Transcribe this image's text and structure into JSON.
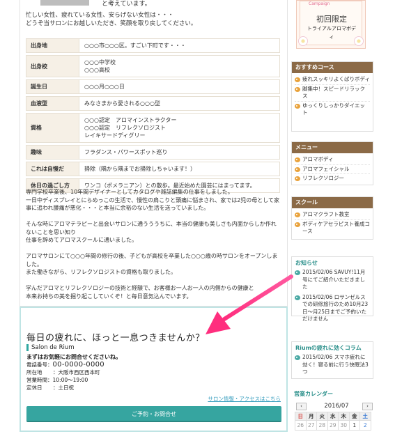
{
  "intro": {
    "tail": "と考えています。",
    "lines": [
      "忙しい女性、疲れている女性、安らげない女性は・・・",
      "どうぞ当サロンにお越しいただき、笑顔を取り戻してください。"
    ]
  },
  "profile": [
    {
      "key": "出身地",
      "value": [
        "○○○市○○○区。すごい下町です・・・"
      ]
    },
    {
      "key": "出身校",
      "value": [
        "○○○中学校",
        "○○○高校"
      ]
    },
    {
      "key": "誕生日",
      "value": [
        "○○○月○○○日"
      ]
    },
    {
      "key": "血液型",
      "value": [
        "みなさまから愛される○○○型"
      ]
    },
    {
      "key": "資格",
      "value": [
        "○○○認定　アロマインストラクター",
        "○○○認定　リフレクソロジスト",
        "レイキサードディグリー"
      ]
    },
    {
      "key": "趣味",
      "value": [
        "フラダンス・パワースポット巡り"
      ]
    },
    {
      "key": "これは自慢だ",
      "value": [
        "掃除（隅から隅までお掃除しちゃいます！）"
      ]
    },
    {
      "key": "休日の過ごし方",
      "value": [
        "ワンコ（ポメラニアン）との散歩。最近始めた園芸にはまってます。"
      ]
    }
  ],
  "body": [
    [
      "専門学校卒業後、10年間デザイナーとしてカタログや雑誌編集の仕事をしました。",
      "一日中ディスプレイとにらめっこの生活で、慢性の肩こりと頭痛に悩まされ、家では2児の母として家事に追われ腰痛が悪化・・・と本当に余裕のない生活を送っていました。"
    ],
    [
      "そんな時にアロマテラピーと出会いサロンに通うううちに、本当の健康も美しさも内面からしか作れないことを思い知り",
      "仕事を辞めてアロマスクールに通いました。"
    ],
    [
      "アロマサロンにて○○○年間の修行の後、子どもが高校を卒業した○○○歳の時サロンをオープンしました。",
      "また働きながら、リフレクソロジストの資格も取りました。"
    ],
    [
      "学んだアロマとリフレクソロジーの技術と経験で、お客様お一人お一人の内側からの健康と",
      "本来お持ちの美を掘り起こしていくぞ！と毎日意気込んでいます。"
    ]
  ],
  "salon": {
    "title": "毎日の疲れに、ほっと一息つきませんか？",
    "name": "Salon de Rium",
    "lead": "まずはお気軽にお問合せくださいね。",
    "tel_label": "電話番号：",
    "tel": "00-0000-0000",
    "addr_label": "所在地",
    "addr": "：大阪市西区西本町",
    "hours_label": "営業時間：",
    "hours": "10:00～19:00",
    "holiday_label": "定休日",
    "holiday": "：土日祝",
    "link": "サロン情報・アクセスはこちら",
    "button": "ご予約・お問合せ"
  },
  "banner": {
    "bunting": "Campaign",
    "title": "初回限定",
    "sub": "トライアルアロマボデ",
    "sub2": "ィ"
  },
  "sidebar": {
    "course": {
      "title": "おすすめコース",
      "items": [
        "疲れスッキリよくばりボディ",
        "脚集中！スピードリラックス",
        "ゆっくりしっかりダイエット"
      ]
    },
    "menu": {
      "title": "メニュー",
      "items": [
        "アロマボディ",
        "アロマフェイシャル",
        "リフレクソロジー"
      ]
    },
    "school": {
      "title": "スクール",
      "items": [
        "アロマクラフト教室",
        "ボディケアセラピスト養成コース"
      ]
    },
    "news": {
      "title": "お知らせ",
      "items": [
        "2015/02/06 SAVUY!11月号にてご紹介いただきました",
        "2015/02/06 ロサンゼルスでの研修旅行のため10月23日～月25日までご予約いただけません"
      ]
    },
    "column": {
      "title": "Riumの疲れに効くコラム",
      "items": [
        "2015/02/06 スマホ疲れに効く！寝る前に行う快眠法3つ"
      ]
    },
    "calendar": {
      "title": "営業カレンダー",
      "month": "2016/07",
      "prev": "‹",
      "next": "›",
      "weekdays": [
        "日",
        "月",
        "火",
        "水",
        "木",
        "金",
        "土"
      ],
      "row1": [
        "26",
        "27",
        "28",
        "29",
        "30",
        "1",
        "2"
      ]
    }
  }
}
